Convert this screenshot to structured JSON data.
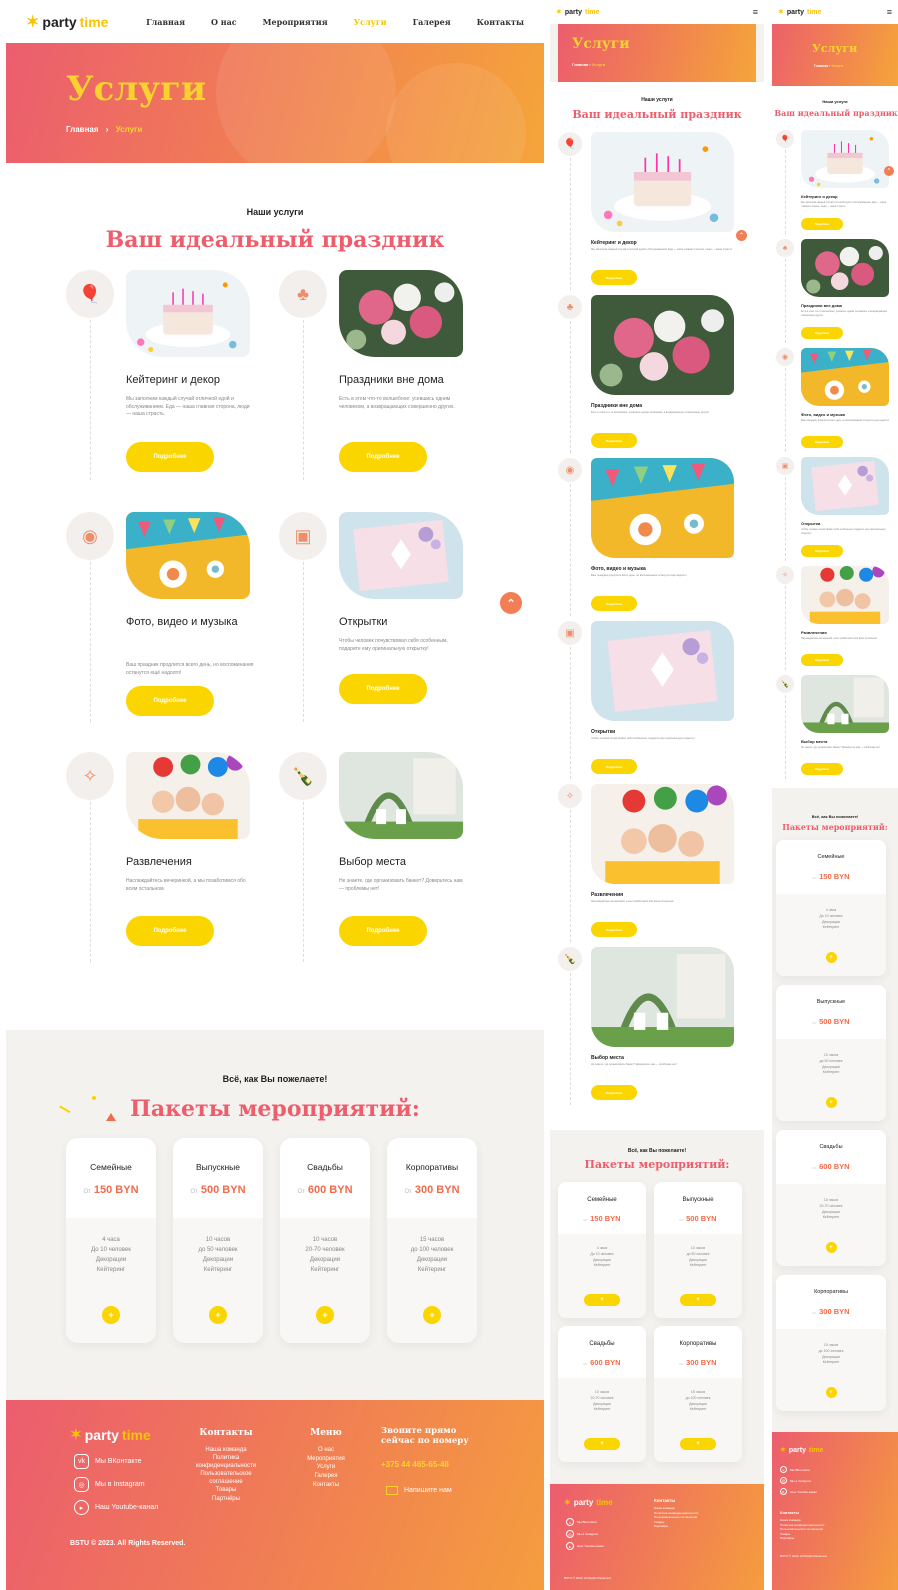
{
  "brand": {
    "party": "party",
    "time": "time"
  },
  "nav": [
    "Главная",
    "О нас",
    "Мероприятия",
    "Услуги",
    "Галерея",
    "Контакты"
  ],
  "nav_active": "Услуги",
  "hero": {
    "title": "Услуги",
    "crumb_home": "Главная",
    "crumb_sep": "›",
    "crumb_current": "Услуги"
  },
  "services_section": {
    "subtitle": "Наши услуги",
    "title": "Ваш идеальный праздник"
  },
  "services": [
    {
      "icon": "balloons-icon",
      "title": "Кейтеринг и декор",
      "text": "Мы заполним каждый случай отличной едой и обслуживанием. Еда — наша главная сторона, люди — наша страсть.",
      "button": "Подробнее",
      "photo": "cake-with-candles"
    },
    {
      "icon": "tree-icon",
      "title": "Праздники вне дома",
      "text": "Есть в этом что-то волшебное: усевшись одним человеком, а возвращающих совершенно других.",
      "button": "Подробнее",
      "photo": "flower-bouquet"
    },
    {
      "icon": "camera-icon",
      "title": "Фото, видео и музыка",
      "text": "Ваш праздник продлится всего день, но воспоминания останутся ещё надолго!",
      "button": "Подробнее",
      "photo": "party-table-flags"
    },
    {
      "icon": "gift-icon",
      "title": "Открытки",
      "text": "Чтобы человек почувствовал себя особенным, подарите ему оригинальную открытку!",
      "button": "Подробнее",
      "photo": "greeting-card"
    },
    {
      "icon": "confetti-icon",
      "title": "Развлечения",
      "text": "Наслаждайтесь вечеринкой, а мы позаботимся обо всем остальном.",
      "button": "Подробнее",
      "photo": "kids-party"
    },
    {
      "icon": "champagne-icon",
      "title": "Выбор места",
      "text": "Не знаете, где организовать банкет? Доверьтесь нам — проблемы нет!",
      "button": "Подробнее",
      "photo": "garden-venue"
    }
  ],
  "packages_section": {
    "subtitle": "Всё, как Вы пожелаете!",
    "title": "Пакеты мероприятий:"
  },
  "packages": [
    {
      "name": "Семейные",
      "from": "От",
      "price": "150 BYN",
      "features": [
        "4 часа",
        "До 10 человек",
        "Декорации",
        "Кейтеринг"
      ],
      "plus": "+"
    },
    {
      "name": "Выпускные",
      "from": "От",
      "price": "500 BYN",
      "features": [
        "10 часов",
        "до 50 человек",
        "Декорации",
        "Кейтеринг"
      ],
      "plus": "+"
    },
    {
      "name": "Свадьбы",
      "from": "От",
      "price": "600 BYN",
      "features": [
        "10 часов",
        "20-70 человек",
        "Декорации",
        "Кейтеринг"
      ],
      "plus": "+"
    },
    {
      "name": "Корпоративы",
      "from": "От",
      "price": "300 BYN",
      "features": [
        "15 часов",
        "до 100 человек",
        "Декорации",
        "Кейтеринг"
      ],
      "plus": "+"
    }
  ],
  "footer": {
    "social": [
      {
        "icon": "vk-icon",
        "label": "Мы ВКонтакте"
      },
      {
        "icon": "instagram-icon",
        "label": "Мы в Instagram"
      },
      {
        "icon": "youtube-icon",
        "label": "Наш Youtube-канал"
      }
    ],
    "contacts_title": "Контакты",
    "contacts_links": [
      "Наша команда",
      "Политика конфиденциальности",
      "Пользовательское соглашение",
      "Товары",
      "Партнёры"
    ],
    "menu_title": "Меню",
    "menu_links": [
      "О нас",
      "Мероприятия",
      "Услуги",
      "Галерея",
      "Контакты"
    ],
    "call_title": "Звоните прямо сейчас по номеру",
    "phone": "+375 44 465-65-48",
    "write_us": "Напишите нам",
    "copyright": "BSTU © 2023. All Rights Reserved."
  },
  "colors": {
    "accent_yellow": "#fbd500",
    "accent_red": "#ee5d6c",
    "accent_orange": "#f26b4a"
  }
}
